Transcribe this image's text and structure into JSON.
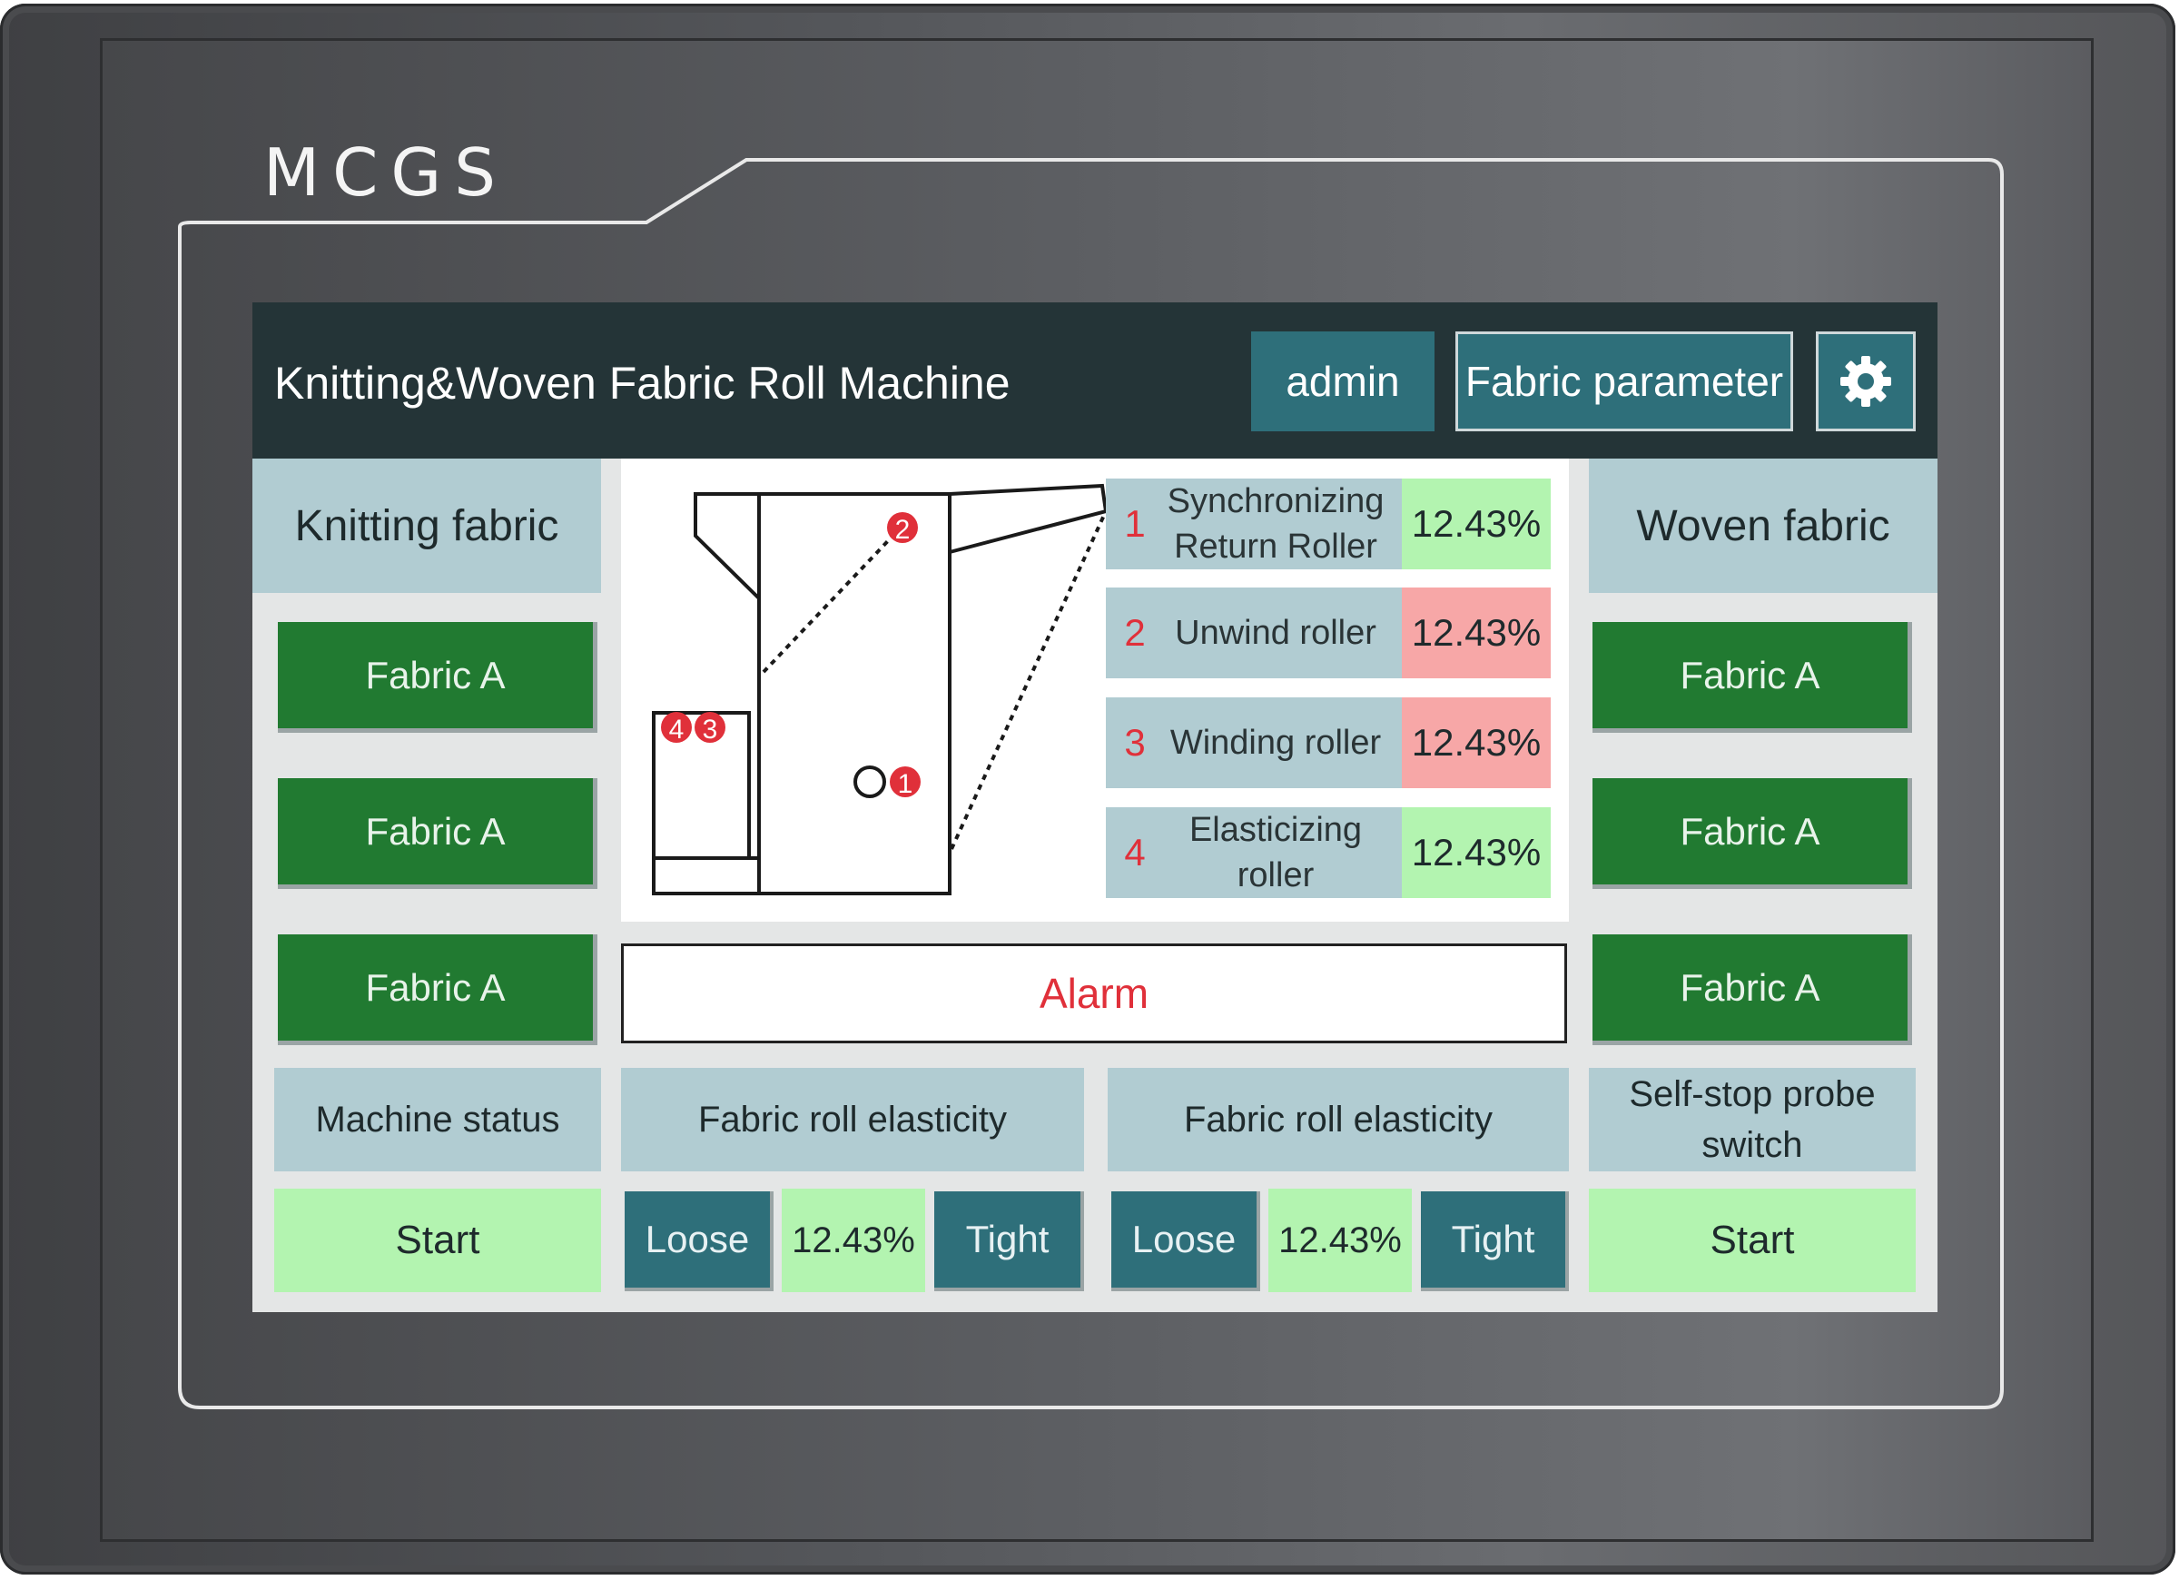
{
  "device": {
    "brand": "MCGS"
  },
  "header": {
    "title": "Knitting&Woven Fabric Roll Machine",
    "user_label": "admin",
    "param_label": "Fabric parameter",
    "settings_icon": "gear-icon"
  },
  "left_panel": {
    "title": "Knitting fabric",
    "buttons": [
      "Fabric A",
      "Fabric A",
      "Fabric A"
    ]
  },
  "right_panel": {
    "title": "Woven fabric",
    "buttons": [
      "Fabric A",
      "Fabric A",
      "Fabric A"
    ]
  },
  "diagram": {
    "markers": [
      "1",
      "2",
      "3",
      "4"
    ]
  },
  "rollers": [
    {
      "num": "1",
      "name": "Synchronizing Return Roller",
      "value": "12.43%",
      "status_color": "#b3f4b0"
    },
    {
      "num": "2",
      "name": "Unwind roller",
      "value": "12.43%",
      "status_color": "#f7a7a7"
    },
    {
      "num": "3",
      "name": "Winding roller",
      "value": "12.43%",
      "status_color": "#f7a7a7"
    },
    {
      "num": "4",
      "name": "Elasticizing roller",
      "value": "12.43%",
      "status_color": "#b3f4b0"
    }
  ],
  "alarm": {
    "label": "Alarm"
  },
  "bottom": {
    "machine_status": {
      "title": "Machine status",
      "value": "Start"
    },
    "elasticity_1": {
      "title": "Fabric roll elasticity",
      "loose": "Loose",
      "value": "12.43%",
      "tight": "Tight"
    },
    "elasticity_2": {
      "title": "Fabric roll elasticity",
      "loose": "Loose",
      "value": "12.43%",
      "tight": "Tight"
    },
    "self_stop": {
      "title": "Self-stop probe switch",
      "value": "Start"
    }
  },
  "colors": {
    "header_bg": "#243437",
    "accent_teal": "#2e6f7a",
    "fabric_green": "#217a31",
    "ok_green": "#b3f4b0",
    "warn_red": "#f7a7a7",
    "panel_blue": "#b1ccd2",
    "alarm_text": "#e0303a"
  }
}
